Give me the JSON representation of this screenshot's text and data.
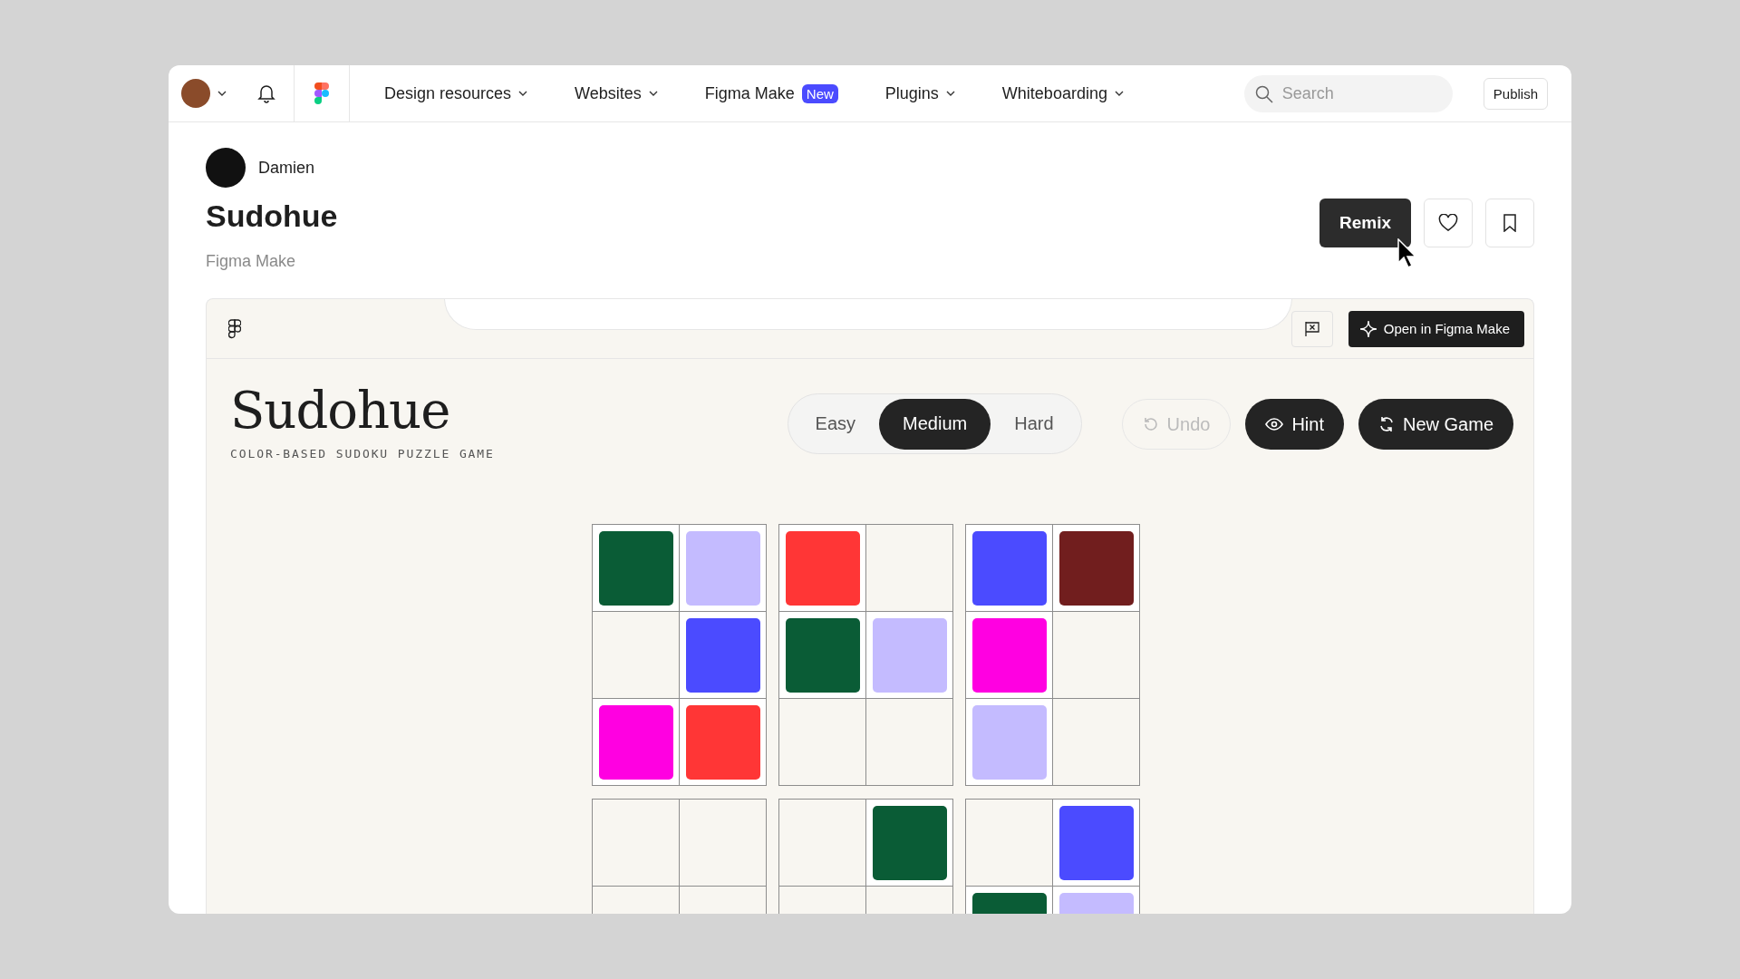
{
  "header": {
    "nav": [
      {
        "label": "Design resources",
        "dropdown": true
      },
      {
        "label": "Websites",
        "dropdown": true
      },
      {
        "label": "Figma Make",
        "dropdown": false,
        "badge": "New"
      },
      {
        "label": "Plugins",
        "dropdown": true
      },
      {
        "label": "Whiteboarding",
        "dropdown": true
      }
    ],
    "search": {
      "placeholder": "Search"
    },
    "publish": "Publish"
  },
  "file": {
    "author": "Damien",
    "title": "Sudohue",
    "subtitle": "Figma Make",
    "remix": "Remix"
  },
  "preview": {
    "open_button": "Open in Figma Make",
    "game": {
      "title": "Sudohue",
      "tagline": "COLOR-BASED SUDOKU PUZZLE GAME",
      "difficulty": [
        {
          "label": "Easy",
          "selected": false
        },
        {
          "label": "Medium",
          "selected": true
        },
        {
          "label": "Hard",
          "selected": false
        }
      ],
      "actions": [
        {
          "kind": "undo",
          "label": "Undo",
          "disabled": true
        },
        {
          "kind": "hint",
          "label": "Hint",
          "disabled": false
        },
        {
          "kind": "new",
          "label": "New Game",
          "disabled": false
        }
      ],
      "grid": [
        [
          {
            "filled": true,
            "color": "#0a5c36"
          },
          {
            "filled": true,
            "color": "#c4bbff"
          },
          {
            "filled": true,
            "color": "#ff3636"
          },
          {
            "filled": false
          },
          {
            "filled": true,
            "color": "#4b4bff"
          },
          {
            "filled": true,
            "color": "#711e1e"
          }
        ],
        [
          {
            "filled": false
          },
          {
            "filled": true,
            "color": "#4b4bff"
          },
          {
            "filled": true,
            "color": "#0a5c36"
          },
          {
            "filled": true,
            "color": "#c4bbff"
          },
          {
            "filled": true,
            "color": "#ff00e1"
          },
          {
            "filled": false
          }
        ],
        [
          {
            "filled": true,
            "color": "#ff00e1"
          },
          {
            "filled": true,
            "color": "#ff3636"
          },
          {
            "filled": false
          },
          {
            "filled": false
          },
          {
            "filled": true,
            "color": "#c4bbff"
          },
          {
            "filled": false
          }
        ],
        [
          {
            "filled": false
          },
          {
            "filled": false
          },
          {
            "filled": false
          },
          {
            "filled": true,
            "color": "#0a5c36"
          },
          {
            "filled": false
          },
          {
            "filled": true,
            "color": "#4b4bff"
          }
        ],
        [
          {
            "filled": false
          },
          {
            "filled": false
          },
          {
            "filled": false
          },
          {
            "filled": false
          },
          {
            "filled": true,
            "color": "#0a5c36"
          },
          {
            "filled": true,
            "color": "#c4bbff"
          }
        ]
      ]
    }
  }
}
